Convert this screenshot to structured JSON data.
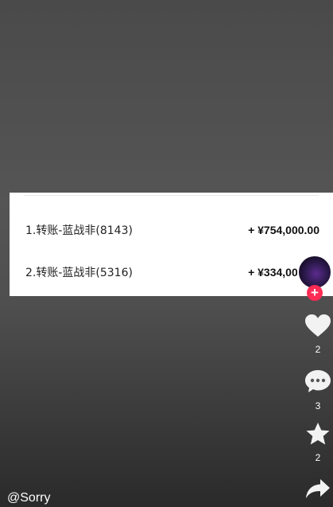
{
  "transactions": [
    {
      "label": "1.转账-蓝战非(8143)",
      "amount": "+ ¥754,000.00"
    },
    {
      "label": "2.转账-蓝战非(5316)",
      "amount": "+ ¥334,000.00"
    }
  ],
  "actions": {
    "follow_symbol": "+",
    "likes": "2",
    "comments": "3",
    "favorites": "2"
  },
  "author": {
    "handle": "@Sorry"
  },
  "colors": {
    "follow_badge": "#ff2c55",
    "card_bg": "#ffffff"
  },
  "icons": [
    "heart-icon",
    "comment-icon",
    "star-icon",
    "share-icon"
  ]
}
